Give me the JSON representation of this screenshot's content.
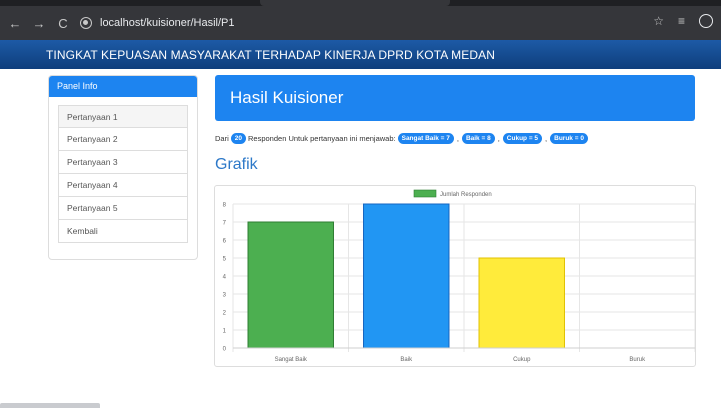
{
  "browser": {
    "url": "localhost/kuisioner/Hasil/P1",
    "back_icon": "←",
    "forward_icon": "→",
    "reload_icon": "C",
    "star_icon": "☆",
    "menu_icon": "≡"
  },
  "navbar": {
    "brand": "TINGKAT KEPUASAN MASYARAKAT TERHADAP KINERJA DPRD KOTA MEDAN"
  },
  "sidebar": {
    "heading": "Panel Info",
    "items": [
      {
        "label": "Pertanyaan 1"
      },
      {
        "label": "Pertanyaan 2"
      },
      {
        "label": "Pertanyaan 3"
      },
      {
        "label": "Pertanyaan 4"
      },
      {
        "label": "Pertanyaan 5"
      },
      {
        "label": "Kembali"
      }
    ]
  },
  "main": {
    "title": "Hasil Kuisioner",
    "result": {
      "prefix": "Dari",
      "count": "20",
      "middle": "Responden Untuk pertanyaan ini menjawab:",
      "badges": [
        "Sangat Baik = 7",
        "Baik = 8",
        "Cukup = 5",
        "Buruk = 0"
      ],
      "separator": ","
    },
    "chart_heading": "Grafik"
  },
  "colors": {
    "accent": "#1d84f0",
    "navbar": "#0e3e7c"
  },
  "chart_data": {
    "type": "bar",
    "categories": [
      "Sangat Baik",
      "Baik",
      "Cukup",
      "Buruk"
    ],
    "series": [
      {
        "name": "Jumlah Responden",
        "values": [
          7,
          8,
          5,
          0
        ]
      }
    ],
    "bar_colors": [
      "#4caf50",
      "#2196f3",
      "#ffeb3b",
      "#9e9e9e"
    ],
    "bar_borders": [
      "#2e7d32",
      "#1565c0",
      "#e0c200",
      "#757575"
    ],
    "legend_color": "#4caf50",
    "ylim": [
      0,
      8
    ],
    "yticks": [
      0,
      1,
      2,
      3,
      4,
      5,
      6,
      7,
      8
    ],
    "grid": true,
    "legend_position": "top"
  }
}
